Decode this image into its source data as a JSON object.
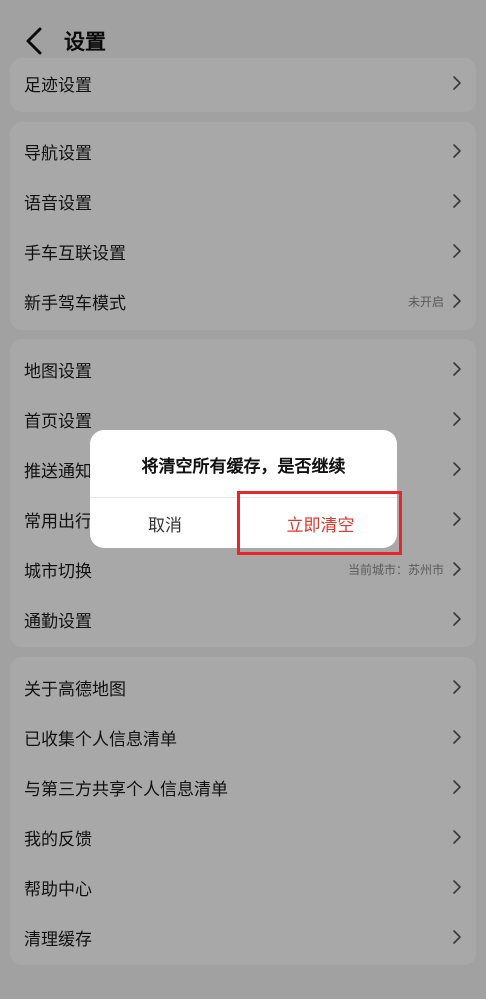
{
  "header": {
    "title": "设置"
  },
  "sections": [
    {
      "items": [
        {
          "label": "足迹设置",
          "value": ""
        }
      ]
    },
    {
      "items": [
        {
          "label": "导航设置",
          "value": ""
        },
        {
          "label": "语音设置",
          "value": ""
        },
        {
          "label": "手车互联设置",
          "value": ""
        },
        {
          "label": "新手驾车模式",
          "value": "未开启"
        }
      ]
    },
    {
      "items": [
        {
          "label": "地图设置",
          "value": ""
        },
        {
          "label": "首页设置",
          "value": ""
        },
        {
          "label": "推送通知",
          "value": ""
        },
        {
          "label": "常用出行",
          "value": ""
        },
        {
          "label": "城市切换",
          "value": "当前城市：苏州市"
        },
        {
          "label": "通勤设置",
          "value": ""
        }
      ]
    },
    {
      "items": [
        {
          "label": "关于高德地图",
          "value": ""
        },
        {
          "label": "已收集个人信息清单",
          "value": ""
        },
        {
          "label": "与第三方共享个人信息清单",
          "value": ""
        },
        {
          "label": "我的反馈",
          "value": ""
        },
        {
          "label": "帮助中心",
          "value": ""
        },
        {
          "label": "清理缓存",
          "value": ""
        }
      ]
    }
  ],
  "dialog": {
    "message": "将清空所有缓存，是否继续",
    "cancel": "取消",
    "confirm": "立即清空"
  },
  "colors": {
    "confirm": "#e5342a",
    "highlight": "#e8262a",
    "overlay": "rgba(0,0,0,0.34)"
  }
}
